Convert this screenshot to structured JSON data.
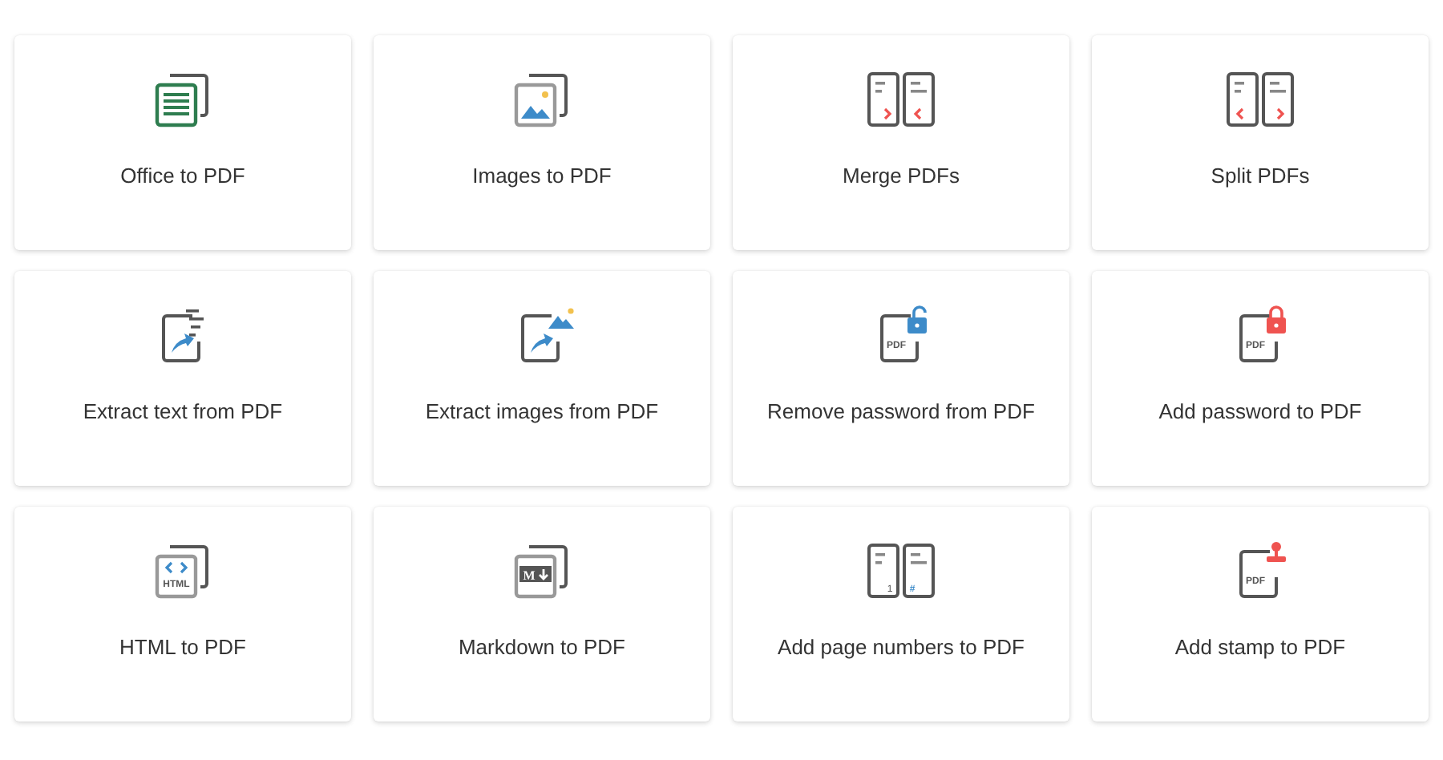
{
  "cards": [
    {
      "label": "Office to PDF",
      "kind": "office"
    },
    {
      "label": "Images to PDF",
      "kind": "images"
    },
    {
      "label": "Merge PDFs",
      "kind": "merge"
    },
    {
      "label": "Split PDFs",
      "kind": "split"
    },
    {
      "label": "Extract text from PDF",
      "kind": "extract-text"
    },
    {
      "label": "Extract images from PDF",
      "kind": "extract-images"
    },
    {
      "label": "Remove password from PDF",
      "kind": "unlock",
      "icon_texts": [
        "PDF"
      ]
    },
    {
      "label": "Add password to PDF",
      "kind": "lock",
      "icon_texts": [
        "PDF"
      ]
    },
    {
      "label": "HTML to PDF",
      "kind": "html",
      "icon_texts": [
        "HTML"
      ]
    },
    {
      "label": "Markdown to PDF",
      "kind": "markdown",
      "icon_texts": [
        "M"
      ]
    },
    {
      "label": "Add page numbers to PDF",
      "kind": "page-numbers",
      "icon_texts": [
        "1",
        "#"
      ]
    },
    {
      "label": "Add stamp to PDF",
      "kind": "stamp",
      "icon_texts": [
        "PDF"
      ]
    }
  ]
}
